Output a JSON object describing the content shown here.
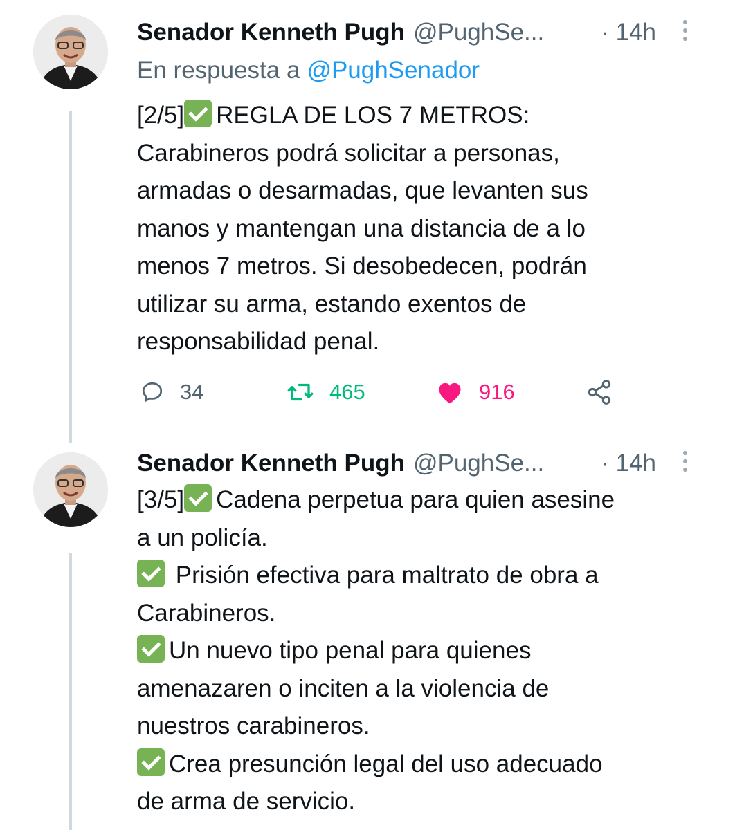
{
  "tweets": [
    {
      "author": {
        "display_name": "Senador Kenneth Pugh",
        "handle": "@PughSe...",
        "avatar_icon": "person-portrait"
      },
      "time": "· 14h",
      "reply_to": {
        "prefix": "En respuesta a",
        "handle": "@PughSenador"
      },
      "body_lines": [
        "[2/5]",
        "REGLA DE LOS 7 METROS:",
        "Carabineros podrá solicitar a personas,",
        "armadas o desarmadas, que levanten sus",
        "manos y mantengan una distancia de a lo",
        "menos 7 metros. Si desobedecen, podrán",
        "utilizar su arma, estando exentos de",
        "responsabilidad penal."
      ],
      "actions": {
        "replies": "34",
        "retweets": "465",
        "likes": "916",
        "liked": true
      }
    },
    {
      "author": {
        "display_name": "Senador Kenneth Pugh",
        "handle": "@PughSe...",
        "avatar_icon": "person-portrait"
      },
      "time": "· 14h",
      "body_lines": [
        "[3/5]",
        "Cadena perpetua para quien asesine",
        "a un policía.",
        "Prisión efectiva para maltrato de obra a",
        "Carabineros.",
        "Un nuevo tipo penal para quienes",
        "amenazaren o inciten a la violencia de",
        "nuestros carabineros.",
        "Crea presunción legal del uso adecuado",
        "de arma de servicio."
      ]
    }
  ],
  "colors": {
    "text": "#0f1419",
    "muted": "#536471",
    "link": "#1d9bf0",
    "retweet": "#00ba7c",
    "like": "#f91880",
    "thread_line": "#cfd9de",
    "check_emoji": "#77b255"
  }
}
